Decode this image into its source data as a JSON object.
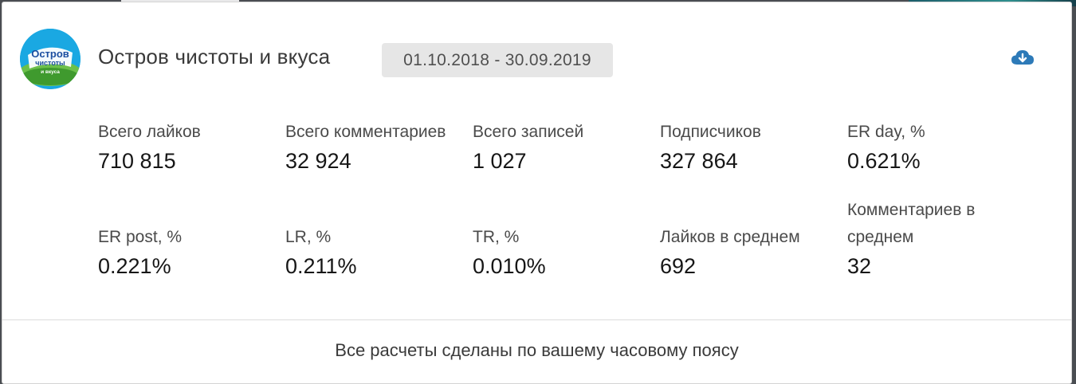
{
  "profile": {
    "name": "Остров чистоты и вкуса",
    "date_range": "01.10.2018 - 30.09.2019",
    "logo": {
      "line1": "Остров",
      "line2": "чистоты",
      "line3": "и вкуса",
      "bg_color": "#1aa8e2"
    }
  },
  "actions": {
    "download_icon": "cloud-download-icon",
    "accent_color": "#2d7ab8"
  },
  "metrics_row1": [
    {
      "label": "Всего лайков",
      "value": "710 815"
    },
    {
      "label": "Всего комментариев",
      "value": "32 924"
    },
    {
      "label": "Всего записей",
      "value": "1 027"
    },
    {
      "label": "Подписчиков",
      "value": "327 864"
    },
    {
      "label": "ER day, %",
      "value": "0.621%"
    }
  ],
  "metrics_row2": [
    {
      "label": "ER post, %",
      "value": "0.221%"
    },
    {
      "label": "LR, %",
      "value": "0.211%"
    },
    {
      "label": "TR, %",
      "value": "0.010%"
    },
    {
      "label": "Лайков в среднем",
      "value": "692"
    },
    {
      "label": "Комментариев в среднем",
      "value": "32"
    }
  ],
  "footer_note": "Все расчеты сделаны по вашему часовому поясу"
}
